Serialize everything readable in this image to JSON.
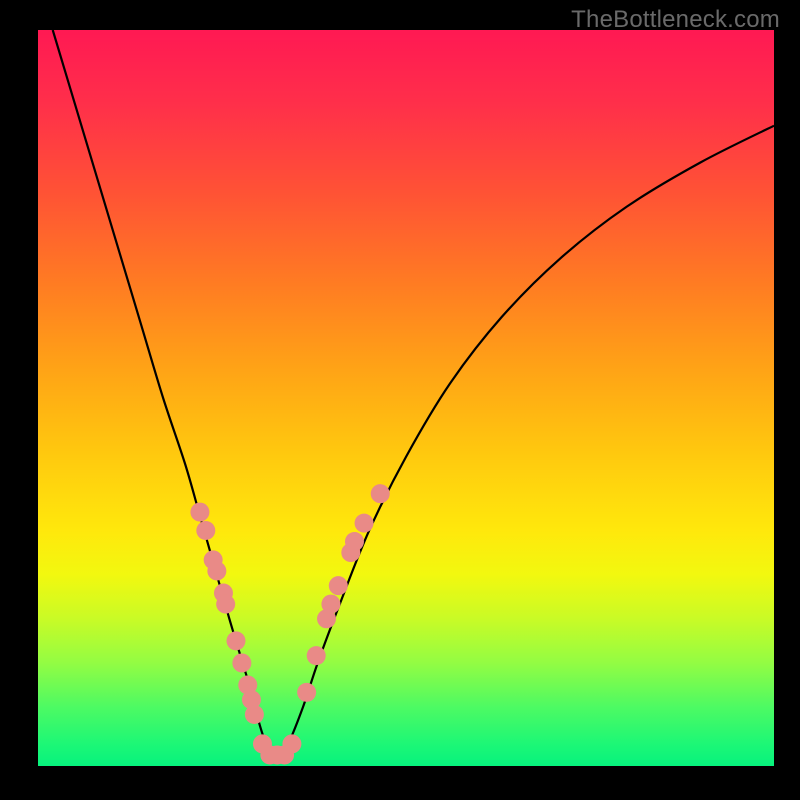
{
  "watermark": "TheBottleneck.com",
  "colors": {
    "curve_stroke": "#000000",
    "marker_fill": "#e98a87",
    "marker_stroke": "#d77570"
  },
  "chart_data": {
    "type": "line",
    "title": "",
    "xlabel": "",
    "ylabel": "",
    "xlim": [
      0,
      100
    ],
    "ylim": [
      0,
      100
    ],
    "grid": false,
    "legend": false,
    "series": [
      {
        "name": "bottleneck-curve",
        "x": [
          2,
          5,
          8,
          11,
          14,
          17,
          20,
          22,
          24,
          26,
          27.5,
          29,
          30,
          31,
          32,
          33,
          34,
          36,
          38,
          41,
          45,
          50,
          56,
          63,
          71,
          80,
          90,
          100
        ],
        "y": [
          100,
          90,
          80,
          70,
          60,
          50,
          41,
          34,
          27,
          20,
          15,
          10,
          6,
          3,
          1.5,
          1.5,
          3,
          8,
          14,
          22,
          32,
          42,
          52,
          61,
          69,
          76,
          82,
          87
        ]
      }
    ],
    "markers": {
      "name": "highlighted-points",
      "points": [
        {
          "x": 22.0,
          "y": 34.5
        },
        {
          "x": 22.8,
          "y": 32.0
        },
        {
          "x": 23.8,
          "y": 28.0
        },
        {
          "x": 24.3,
          "y": 26.5
        },
        {
          "x": 25.2,
          "y": 23.5
        },
        {
          "x": 25.5,
          "y": 22.0
        },
        {
          "x": 26.9,
          "y": 17.0
        },
        {
          "x": 27.7,
          "y": 14.0
        },
        {
          "x": 28.5,
          "y": 11.0
        },
        {
          "x": 29.0,
          "y": 9.0
        },
        {
          "x": 29.4,
          "y": 7.0
        },
        {
          "x": 30.5,
          "y": 3.0
        },
        {
          "x": 31.5,
          "y": 1.5
        },
        {
          "x": 32.5,
          "y": 1.5
        },
        {
          "x": 33.5,
          "y": 1.5
        },
        {
          "x": 34.5,
          "y": 3.0
        },
        {
          "x": 36.5,
          "y": 10.0
        },
        {
          "x": 37.8,
          "y": 15.0
        },
        {
          "x": 39.2,
          "y": 20.0
        },
        {
          "x": 39.8,
          "y": 22.0
        },
        {
          "x": 40.8,
          "y": 24.5
        },
        {
          "x": 42.5,
          "y": 29.0
        },
        {
          "x": 43.0,
          "y": 30.5
        },
        {
          "x": 44.3,
          "y": 33.0
        },
        {
          "x": 46.5,
          "y": 37.0
        }
      ]
    }
  }
}
